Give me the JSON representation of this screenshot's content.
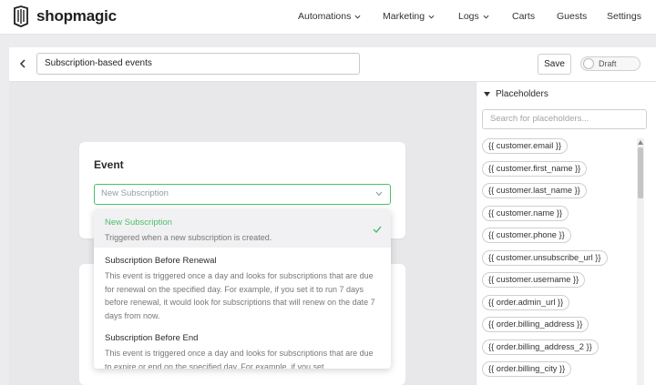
{
  "app": {
    "name": "shopmagic"
  },
  "nav": {
    "items": [
      {
        "label": "Automations",
        "dropdown": true
      },
      {
        "label": "Marketing",
        "dropdown": true
      },
      {
        "label": "Logs",
        "dropdown": true
      },
      {
        "label": "Carts",
        "dropdown": false
      },
      {
        "label": "Guests",
        "dropdown": false
      },
      {
        "label": "Settings",
        "dropdown": false
      }
    ]
  },
  "editor": {
    "title_value": "Subscription-based events",
    "save_label": "Save",
    "status_label": "Draft"
  },
  "event": {
    "heading": "Event",
    "select_placeholder": "New Subscription",
    "options": [
      {
        "title": "New Subscription",
        "desc": "Triggered when a new subscription is created.",
        "selected": true
      },
      {
        "title": "Subscription Before Renewal",
        "desc": "This event is triggered once a day and looks for subscriptions that are due for renewal on the specified day. For example, if you set it to run 7 days before renewal, it would look for subscriptions that will renew on the date 7 days from now.",
        "selected": false
      },
      {
        "title": "Subscription Before End",
        "desc": "This event is triggered once a day and looks for subscriptions that are due to expire or end on the specified day. For example, if you set",
        "selected": false
      }
    ]
  },
  "placeholders": {
    "heading": "Placeholders",
    "search_placeholder": "Search for placeholders...",
    "items": [
      "{{ customer.email }}",
      "{{ customer.first_name }}",
      "{{ customer.last_name }}",
      "{{ customer.name }}",
      "{{ customer.phone }}",
      "{{ customer.unsubscribe_url }}",
      "{{ customer.username }}",
      "{{ order.admin_url }}",
      "{{ order.billing_address }}",
      "{{ order.billing_address_2 }}",
      "{{ order.billing_city }}"
    ]
  },
  "colors": {
    "accent": "#4cbf6a"
  }
}
